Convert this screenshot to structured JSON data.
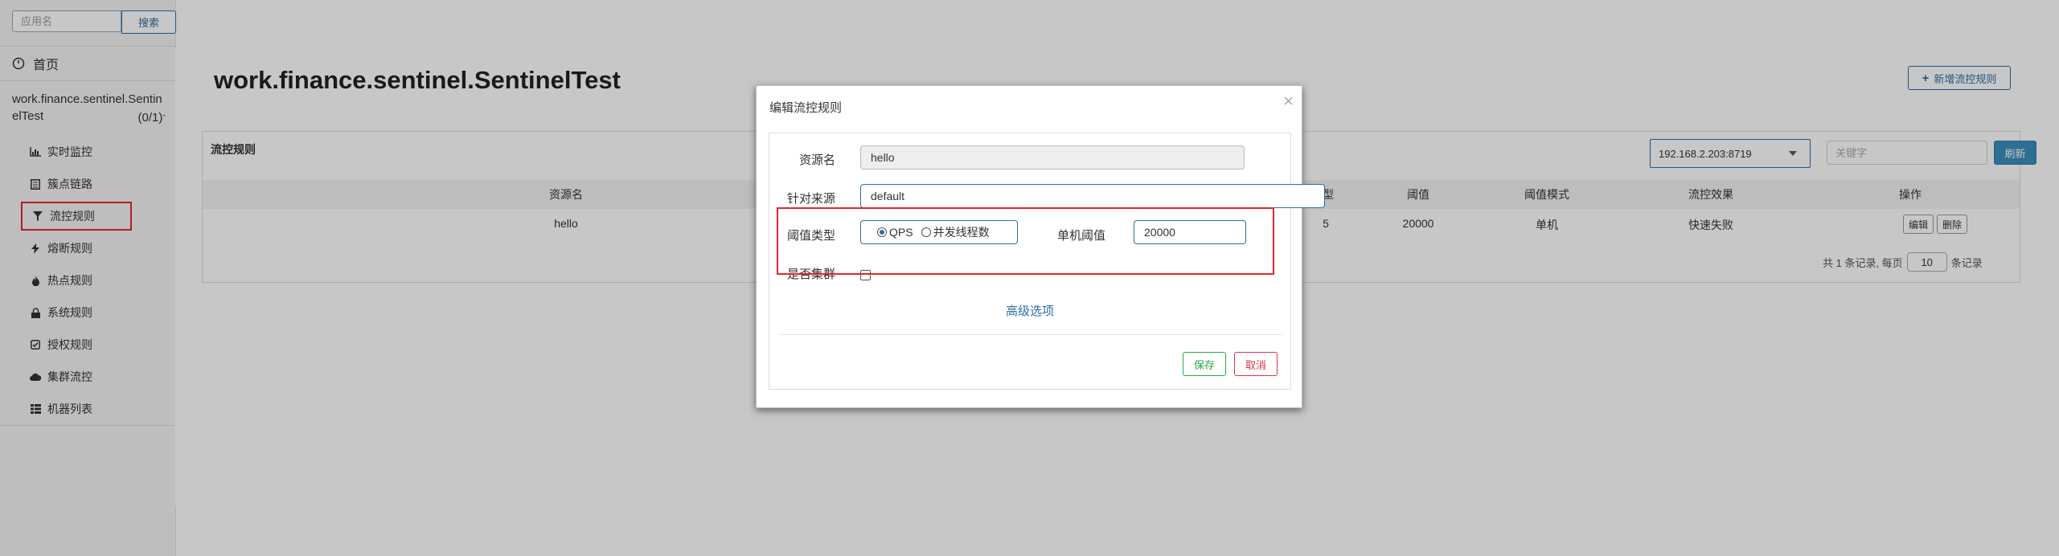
{
  "sidebar": {
    "search_placeholder": "应用名",
    "search_button": "搜索",
    "home_label": "首页",
    "app_name": "work.finance.sentinel.SentinelTest",
    "app_count": "(0/1)",
    "items": [
      {
        "label": "实时监控",
        "icon": "bar-chart-icon"
      },
      {
        "label": "簇点链路",
        "icon": "list-icon"
      },
      {
        "label": "流控规则",
        "icon": "filter-icon",
        "active": true
      },
      {
        "label": "熔断规则",
        "icon": "bolt-icon"
      },
      {
        "label": "热点规则",
        "icon": "fire-icon"
      },
      {
        "label": "系统规则",
        "icon": "lock-icon"
      },
      {
        "label": "授权规则",
        "icon": "check-square-icon"
      },
      {
        "label": "集群流控",
        "icon": "cloud-icon"
      },
      {
        "label": "机器列表",
        "icon": "table-icon"
      }
    ]
  },
  "main": {
    "title": "work.finance.sentinel.SentinelTest",
    "add_button": "新增流控规则",
    "panel_title": "流控规则",
    "machine_select": "192.168.2.203:8719",
    "keyword_placeholder": "关键字",
    "refresh_button": "刷新",
    "table": {
      "headers": [
        "资源名",
        "型",
        "阈值",
        "阈值模式",
        "流控效果",
        "操作"
      ],
      "rows": [
        {
          "resource": "hello",
          "type_fragment": "5",
          "threshold": "20000",
          "mode": "单机",
          "effect": "快速失败",
          "edit": "编辑",
          "delete": "删除"
        }
      ]
    },
    "pager": {
      "prefix": "共 1 条记录, 每页",
      "page_size": "10",
      "suffix": "条记录"
    }
  },
  "modal": {
    "title": "编辑流控规则",
    "close": "×",
    "resource_label": "资源名",
    "resource_value": "hello",
    "source_label": "针对来源",
    "source_value": "default",
    "threshold_type_label": "阈值类型",
    "radio_qps": "QPS",
    "radio_threads": "并发线程数",
    "single_threshold_label": "单机阈值",
    "single_threshold_value": "20000",
    "cluster_label": "是否集群",
    "advanced_link": "高级选项",
    "save_button": "保存",
    "cancel_button": "取消"
  },
  "colors": {
    "accent": "#2e6da4",
    "highlight": "#e3262e",
    "save": "#28a745",
    "cancel": "#dc3545"
  }
}
